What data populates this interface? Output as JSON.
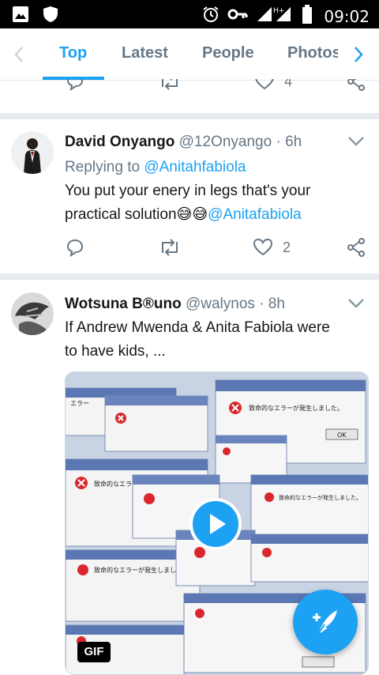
{
  "status_bar": {
    "time": "09:02",
    "network": "H+"
  },
  "tabs": [
    "Top",
    "Latest",
    "People",
    "Photos"
  ],
  "prev_tweet": {
    "likes": "4"
  },
  "tweet1": {
    "name": "David Onyango",
    "handle": "@12Onyango",
    "time": "· 6h",
    "replying_prefix": "Replying to ",
    "replying_to": "@Anitahfabiola",
    "text": "You put your enery in legs that's your practical solution",
    "emoji": "😅😅",
    "mention": "@Anitafabiola",
    "likes": "2"
  },
  "tweet2": {
    "name": "Wotsuna B®uno",
    "handle": "@walynos",
    "time": "· 8h",
    "text_line1": "If Andrew Mwenda & Anita Fabiola were",
    "text_line2": "to have kids, ...",
    "gif_badge": "GIF",
    "dialog_text": "致命的なエラーが発生しました。",
    "dialog_title": "エラー",
    "ok": "OK"
  },
  "colors": {
    "accent": "#1da1f2",
    "muted": "#657786"
  }
}
